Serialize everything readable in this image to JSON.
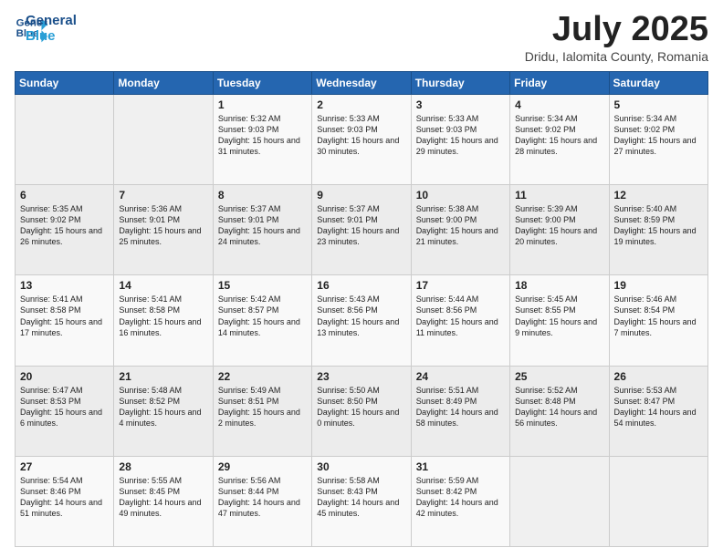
{
  "logo": {
    "line1": "General",
    "line2": "Blue"
  },
  "title": "July 2025",
  "subtitle": "Dridu, Ialomita County, Romania",
  "days_of_week": [
    "Sunday",
    "Monday",
    "Tuesday",
    "Wednesday",
    "Thursday",
    "Friday",
    "Saturday"
  ],
  "weeks": [
    [
      {
        "day": "",
        "sunrise": "",
        "sunset": "",
        "daylight": ""
      },
      {
        "day": "",
        "sunrise": "",
        "sunset": "",
        "daylight": ""
      },
      {
        "day": "1",
        "sunrise": "Sunrise: 5:32 AM",
        "sunset": "Sunset: 9:03 PM",
        "daylight": "Daylight: 15 hours and 31 minutes."
      },
      {
        "day": "2",
        "sunrise": "Sunrise: 5:33 AM",
        "sunset": "Sunset: 9:03 PM",
        "daylight": "Daylight: 15 hours and 30 minutes."
      },
      {
        "day": "3",
        "sunrise": "Sunrise: 5:33 AM",
        "sunset": "Sunset: 9:03 PM",
        "daylight": "Daylight: 15 hours and 29 minutes."
      },
      {
        "day": "4",
        "sunrise": "Sunrise: 5:34 AM",
        "sunset": "Sunset: 9:02 PM",
        "daylight": "Daylight: 15 hours and 28 minutes."
      },
      {
        "day": "5",
        "sunrise": "Sunrise: 5:34 AM",
        "sunset": "Sunset: 9:02 PM",
        "daylight": "Daylight: 15 hours and 27 minutes."
      }
    ],
    [
      {
        "day": "6",
        "sunrise": "Sunrise: 5:35 AM",
        "sunset": "Sunset: 9:02 PM",
        "daylight": "Daylight: 15 hours and 26 minutes."
      },
      {
        "day": "7",
        "sunrise": "Sunrise: 5:36 AM",
        "sunset": "Sunset: 9:01 PM",
        "daylight": "Daylight: 15 hours and 25 minutes."
      },
      {
        "day": "8",
        "sunrise": "Sunrise: 5:37 AM",
        "sunset": "Sunset: 9:01 PM",
        "daylight": "Daylight: 15 hours and 24 minutes."
      },
      {
        "day": "9",
        "sunrise": "Sunrise: 5:37 AM",
        "sunset": "Sunset: 9:01 PM",
        "daylight": "Daylight: 15 hours and 23 minutes."
      },
      {
        "day": "10",
        "sunrise": "Sunrise: 5:38 AM",
        "sunset": "Sunset: 9:00 PM",
        "daylight": "Daylight: 15 hours and 21 minutes."
      },
      {
        "day": "11",
        "sunrise": "Sunrise: 5:39 AM",
        "sunset": "Sunset: 9:00 PM",
        "daylight": "Daylight: 15 hours and 20 minutes."
      },
      {
        "day": "12",
        "sunrise": "Sunrise: 5:40 AM",
        "sunset": "Sunset: 8:59 PM",
        "daylight": "Daylight: 15 hours and 19 minutes."
      }
    ],
    [
      {
        "day": "13",
        "sunrise": "Sunrise: 5:41 AM",
        "sunset": "Sunset: 8:58 PM",
        "daylight": "Daylight: 15 hours and 17 minutes."
      },
      {
        "day": "14",
        "sunrise": "Sunrise: 5:41 AM",
        "sunset": "Sunset: 8:58 PM",
        "daylight": "Daylight: 15 hours and 16 minutes."
      },
      {
        "day": "15",
        "sunrise": "Sunrise: 5:42 AM",
        "sunset": "Sunset: 8:57 PM",
        "daylight": "Daylight: 15 hours and 14 minutes."
      },
      {
        "day": "16",
        "sunrise": "Sunrise: 5:43 AM",
        "sunset": "Sunset: 8:56 PM",
        "daylight": "Daylight: 15 hours and 13 minutes."
      },
      {
        "day": "17",
        "sunrise": "Sunrise: 5:44 AM",
        "sunset": "Sunset: 8:56 PM",
        "daylight": "Daylight: 15 hours and 11 minutes."
      },
      {
        "day": "18",
        "sunrise": "Sunrise: 5:45 AM",
        "sunset": "Sunset: 8:55 PM",
        "daylight": "Daylight: 15 hours and 9 minutes."
      },
      {
        "day": "19",
        "sunrise": "Sunrise: 5:46 AM",
        "sunset": "Sunset: 8:54 PM",
        "daylight": "Daylight: 15 hours and 7 minutes."
      }
    ],
    [
      {
        "day": "20",
        "sunrise": "Sunrise: 5:47 AM",
        "sunset": "Sunset: 8:53 PM",
        "daylight": "Daylight: 15 hours and 6 minutes."
      },
      {
        "day": "21",
        "sunrise": "Sunrise: 5:48 AM",
        "sunset": "Sunset: 8:52 PM",
        "daylight": "Daylight: 15 hours and 4 minutes."
      },
      {
        "day": "22",
        "sunrise": "Sunrise: 5:49 AM",
        "sunset": "Sunset: 8:51 PM",
        "daylight": "Daylight: 15 hours and 2 minutes."
      },
      {
        "day": "23",
        "sunrise": "Sunrise: 5:50 AM",
        "sunset": "Sunset: 8:50 PM",
        "daylight": "Daylight: 15 hours and 0 minutes."
      },
      {
        "day": "24",
        "sunrise": "Sunrise: 5:51 AM",
        "sunset": "Sunset: 8:49 PM",
        "daylight": "Daylight: 14 hours and 58 minutes."
      },
      {
        "day": "25",
        "sunrise": "Sunrise: 5:52 AM",
        "sunset": "Sunset: 8:48 PM",
        "daylight": "Daylight: 14 hours and 56 minutes."
      },
      {
        "day": "26",
        "sunrise": "Sunrise: 5:53 AM",
        "sunset": "Sunset: 8:47 PM",
        "daylight": "Daylight: 14 hours and 54 minutes."
      }
    ],
    [
      {
        "day": "27",
        "sunrise": "Sunrise: 5:54 AM",
        "sunset": "Sunset: 8:46 PM",
        "daylight": "Daylight: 14 hours and 51 minutes."
      },
      {
        "day": "28",
        "sunrise": "Sunrise: 5:55 AM",
        "sunset": "Sunset: 8:45 PM",
        "daylight": "Daylight: 14 hours and 49 minutes."
      },
      {
        "day": "29",
        "sunrise": "Sunrise: 5:56 AM",
        "sunset": "Sunset: 8:44 PM",
        "daylight": "Daylight: 14 hours and 47 minutes."
      },
      {
        "day": "30",
        "sunrise": "Sunrise: 5:58 AM",
        "sunset": "Sunset: 8:43 PM",
        "daylight": "Daylight: 14 hours and 45 minutes."
      },
      {
        "day": "31",
        "sunrise": "Sunrise: 5:59 AM",
        "sunset": "Sunset: 8:42 PM",
        "daylight": "Daylight: 14 hours and 42 minutes."
      },
      {
        "day": "",
        "sunrise": "",
        "sunset": "",
        "daylight": ""
      },
      {
        "day": "",
        "sunrise": "",
        "sunset": "",
        "daylight": ""
      }
    ]
  ]
}
